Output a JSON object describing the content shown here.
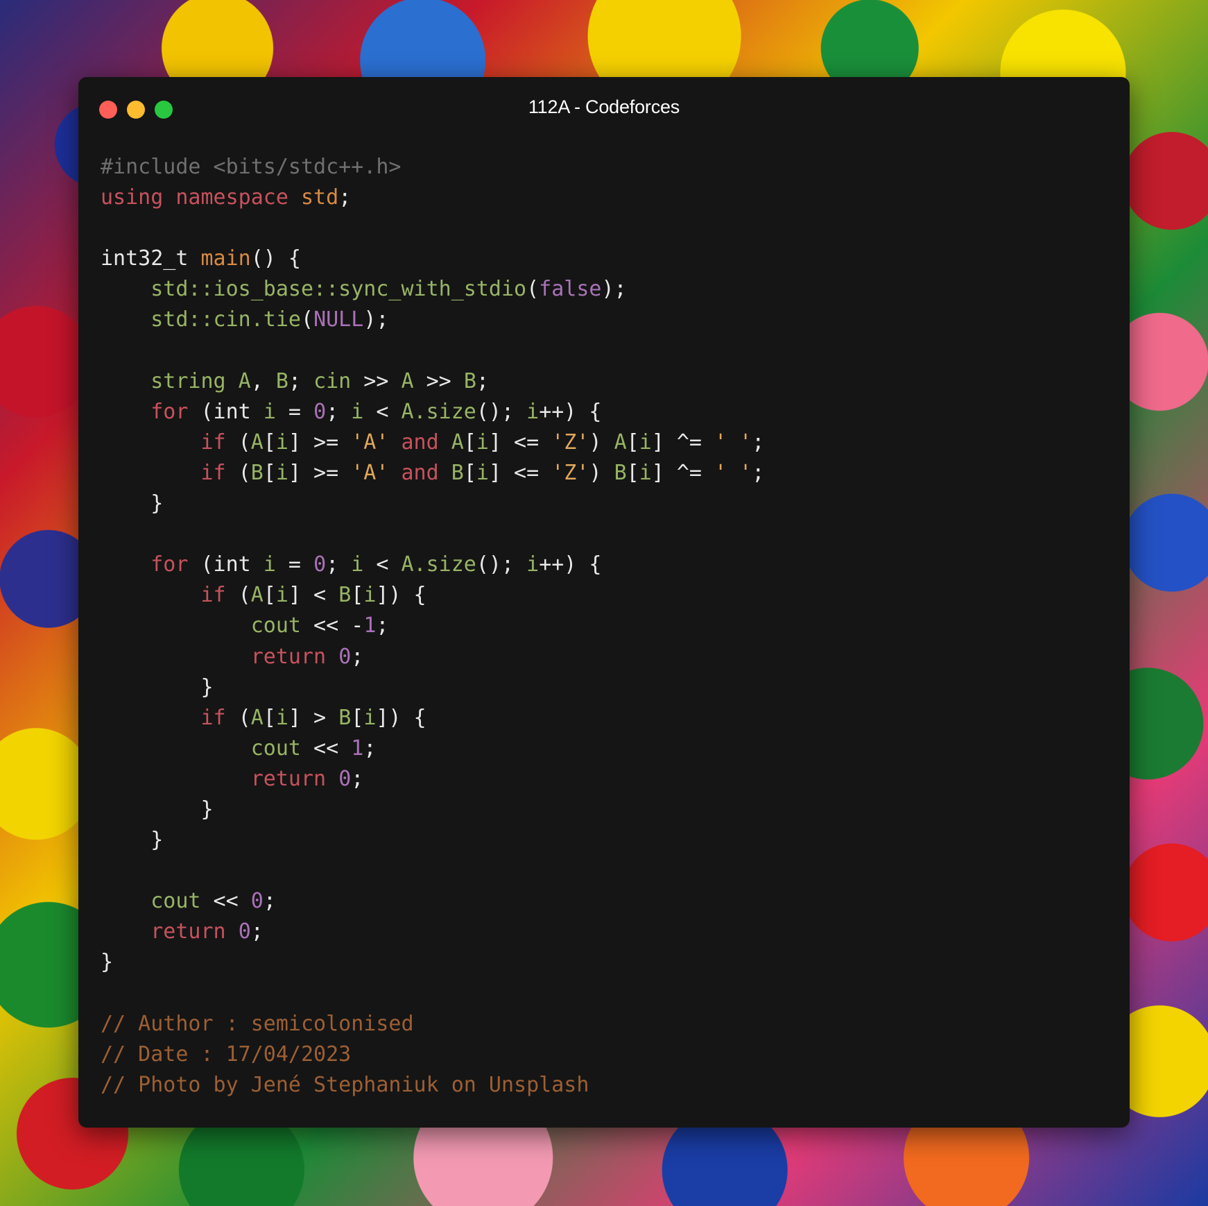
{
  "window": {
    "title": "112A - Codeforces"
  },
  "colors": {
    "window_bg": "#151515",
    "close": "#ff5f57",
    "minimize": "#febc2e",
    "maximize": "#28c840",
    "keyword": "#c6525d",
    "function": "#d98a42",
    "identifier": "#98b465",
    "number": "#a972b6",
    "string": "#e0a85a",
    "comment": "#9c5f34",
    "preprocessor": "#6f6f6f",
    "plain": "#e8e8e8"
  },
  "code": {
    "lines": [
      [
        {
          "t": "pp",
          "v": "#include <bits/stdc++.h>"
        }
      ],
      [
        {
          "t": "kw",
          "v": "using"
        },
        {
          "t": "op",
          "v": " "
        },
        {
          "t": "kw",
          "v": "namespace"
        },
        {
          "t": "op",
          "v": " "
        },
        {
          "t": "kw2",
          "v": "std"
        },
        {
          "t": "op",
          "v": ";"
        }
      ],
      [],
      [
        {
          "t": "ty",
          "v": "int32_t"
        },
        {
          "t": "op",
          "v": " "
        },
        {
          "t": "fn",
          "v": "main"
        },
        {
          "t": "op",
          "v": "() {"
        }
      ],
      [
        {
          "t": "op",
          "v": "    "
        },
        {
          "t": "id",
          "v": "std::ios_base::sync_with_stdio"
        },
        {
          "t": "op",
          "v": "("
        },
        {
          "t": "cst",
          "v": "false"
        },
        {
          "t": "op",
          "v": ");"
        }
      ],
      [
        {
          "t": "op",
          "v": "    "
        },
        {
          "t": "id",
          "v": "std::cin.tie"
        },
        {
          "t": "op",
          "v": "("
        },
        {
          "t": "cst",
          "v": "NULL"
        },
        {
          "t": "op",
          "v": ");"
        }
      ],
      [],
      [
        {
          "t": "op",
          "v": "    "
        },
        {
          "t": "id",
          "v": "string A"
        },
        {
          "t": "op",
          "v": ", "
        },
        {
          "t": "id",
          "v": "B"
        },
        {
          "t": "op",
          "v": "; "
        },
        {
          "t": "id",
          "v": "cin"
        },
        {
          "t": "op",
          "v": " >> "
        },
        {
          "t": "id",
          "v": "A"
        },
        {
          "t": "op",
          "v": " >> "
        },
        {
          "t": "id",
          "v": "B"
        },
        {
          "t": "op",
          "v": ";"
        }
      ],
      [
        {
          "t": "op",
          "v": "    "
        },
        {
          "t": "kw",
          "v": "for"
        },
        {
          "t": "op",
          "v": " (int "
        },
        {
          "t": "id",
          "v": "i"
        },
        {
          "t": "op",
          "v": " = "
        },
        {
          "t": "num",
          "v": "0"
        },
        {
          "t": "op",
          "v": "; "
        },
        {
          "t": "id",
          "v": "i"
        },
        {
          "t": "op",
          "v": " < "
        },
        {
          "t": "id",
          "v": "A.size"
        },
        {
          "t": "op",
          "v": "(); "
        },
        {
          "t": "id",
          "v": "i"
        },
        {
          "t": "op",
          "v": "++) {"
        }
      ],
      [
        {
          "t": "op",
          "v": "        "
        },
        {
          "t": "kw",
          "v": "if"
        },
        {
          "t": "op",
          "v": " ("
        },
        {
          "t": "id",
          "v": "A"
        },
        {
          "t": "op",
          "v": "["
        },
        {
          "t": "id",
          "v": "i"
        },
        {
          "t": "op",
          "v": "] >= "
        },
        {
          "t": "str",
          "v": "'A'"
        },
        {
          "t": "op",
          "v": " "
        },
        {
          "t": "kw",
          "v": "and"
        },
        {
          "t": "op",
          "v": " "
        },
        {
          "t": "id",
          "v": "A"
        },
        {
          "t": "op",
          "v": "["
        },
        {
          "t": "id",
          "v": "i"
        },
        {
          "t": "op",
          "v": "] <= "
        },
        {
          "t": "str",
          "v": "'Z'"
        },
        {
          "t": "op",
          "v": ") "
        },
        {
          "t": "id",
          "v": "A"
        },
        {
          "t": "op",
          "v": "["
        },
        {
          "t": "id",
          "v": "i"
        },
        {
          "t": "op",
          "v": "] ^= "
        },
        {
          "t": "str",
          "v": "' '"
        },
        {
          "t": "op",
          "v": ";"
        }
      ],
      [
        {
          "t": "op",
          "v": "        "
        },
        {
          "t": "kw",
          "v": "if"
        },
        {
          "t": "op",
          "v": " ("
        },
        {
          "t": "id",
          "v": "B"
        },
        {
          "t": "op",
          "v": "["
        },
        {
          "t": "id",
          "v": "i"
        },
        {
          "t": "op",
          "v": "] >= "
        },
        {
          "t": "str",
          "v": "'A'"
        },
        {
          "t": "op",
          "v": " "
        },
        {
          "t": "kw",
          "v": "and"
        },
        {
          "t": "op",
          "v": " "
        },
        {
          "t": "id",
          "v": "B"
        },
        {
          "t": "op",
          "v": "["
        },
        {
          "t": "id",
          "v": "i"
        },
        {
          "t": "op",
          "v": "] <= "
        },
        {
          "t": "str",
          "v": "'Z'"
        },
        {
          "t": "op",
          "v": ") "
        },
        {
          "t": "id",
          "v": "B"
        },
        {
          "t": "op",
          "v": "["
        },
        {
          "t": "id",
          "v": "i"
        },
        {
          "t": "op",
          "v": "] ^= "
        },
        {
          "t": "str",
          "v": "' '"
        },
        {
          "t": "op",
          "v": ";"
        }
      ],
      [
        {
          "t": "op",
          "v": "    }"
        }
      ],
      [],
      [
        {
          "t": "op",
          "v": "    "
        },
        {
          "t": "kw",
          "v": "for"
        },
        {
          "t": "op",
          "v": " (int "
        },
        {
          "t": "id",
          "v": "i"
        },
        {
          "t": "op",
          "v": " = "
        },
        {
          "t": "num",
          "v": "0"
        },
        {
          "t": "op",
          "v": "; "
        },
        {
          "t": "id",
          "v": "i"
        },
        {
          "t": "op",
          "v": " < "
        },
        {
          "t": "id",
          "v": "A.size"
        },
        {
          "t": "op",
          "v": "(); "
        },
        {
          "t": "id",
          "v": "i"
        },
        {
          "t": "op",
          "v": "++) {"
        }
      ],
      [
        {
          "t": "op",
          "v": "        "
        },
        {
          "t": "kw",
          "v": "if"
        },
        {
          "t": "op",
          "v": " ("
        },
        {
          "t": "id",
          "v": "A"
        },
        {
          "t": "op",
          "v": "["
        },
        {
          "t": "id",
          "v": "i"
        },
        {
          "t": "op",
          "v": "] < "
        },
        {
          "t": "id",
          "v": "B"
        },
        {
          "t": "op",
          "v": "["
        },
        {
          "t": "id",
          "v": "i"
        },
        {
          "t": "op",
          "v": "]) {"
        }
      ],
      [
        {
          "t": "op",
          "v": "            "
        },
        {
          "t": "id",
          "v": "cout"
        },
        {
          "t": "op",
          "v": " << -"
        },
        {
          "t": "num",
          "v": "1"
        },
        {
          "t": "op",
          "v": ";"
        }
      ],
      [
        {
          "t": "op",
          "v": "            "
        },
        {
          "t": "kw",
          "v": "return"
        },
        {
          "t": "op",
          "v": " "
        },
        {
          "t": "num",
          "v": "0"
        },
        {
          "t": "op",
          "v": ";"
        }
      ],
      [
        {
          "t": "op",
          "v": "        }"
        }
      ],
      [
        {
          "t": "op",
          "v": "        "
        },
        {
          "t": "kw",
          "v": "if"
        },
        {
          "t": "op",
          "v": " ("
        },
        {
          "t": "id",
          "v": "A"
        },
        {
          "t": "op",
          "v": "["
        },
        {
          "t": "id",
          "v": "i"
        },
        {
          "t": "op",
          "v": "] > "
        },
        {
          "t": "id",
          "v": "B"
        },
        {
          "t": "op",
          "v": "["
        },
        {
          "t": "id",
          "v": "i"
        },
        {
          "t": "op",
          "v": "]) {"
        }
      ],
      [
        {
          "t": "op",
          "v": "            "
        },
        {
          "t": "id",
          "v": "cout"
        },
        {
          "t": "op",
          "v": " << "
        },
        {
          "t": "num",
          "v": "1"
        },
        {
          "t": "op",
          "v": ";"
        }
      ],
      [
        {
          "t": "op",
          "v": "            "
        },
        {
          "t": "kw",
          "v": "return"
        },
        {
          "t": "op",
          "v": " "
        },
        {
          "t": "num",
          "v": "0"
        },
        {
          "t": "op",
          "v": ";"
        }
      ],
      [
        {
          "t": "op",
          "v": "        }"
        }
      ],
      [
        {
          "t": "op",
          "v": "    }"
        }
      ],
      [],
      [
        {
          "t": "op",
          "v": "    "
        },
        {
          "t": "id",
          "v": "cout"
        },
        {
          "t": "op",
          "v": " << "
        },
        {
          "t": "num",
          "v": "0"
        },
        {
          "t": "op",
          "v": ";"
        }
      ],
      [
        {
          "t": "op",
          "v": "    "
        },
        {
          "t": "kw",
          "v": "return"
        },
        {
          "t": "op",
          "v": " "
        },
        {
          "t": "num",
          "v": "0"
        },
        {
          "t": "op",
          "v": ";"
        }
      ],
      [
        {
          "t": "op",
          "v": "}"
        }
      ],
      [],
      [
        {
          "t": "cm",
          "v": "// Author : semicolonised"
        }
      ],
      [
        {
          "t": "cm",
          "v": "// Date : 17/04/2023"
        }
      ],
      [
        {
          "t": "cm",
          "v": "// Photo by Jené Stephaniuk on Unsplash"
        }
      ]
    ]
  }
}
